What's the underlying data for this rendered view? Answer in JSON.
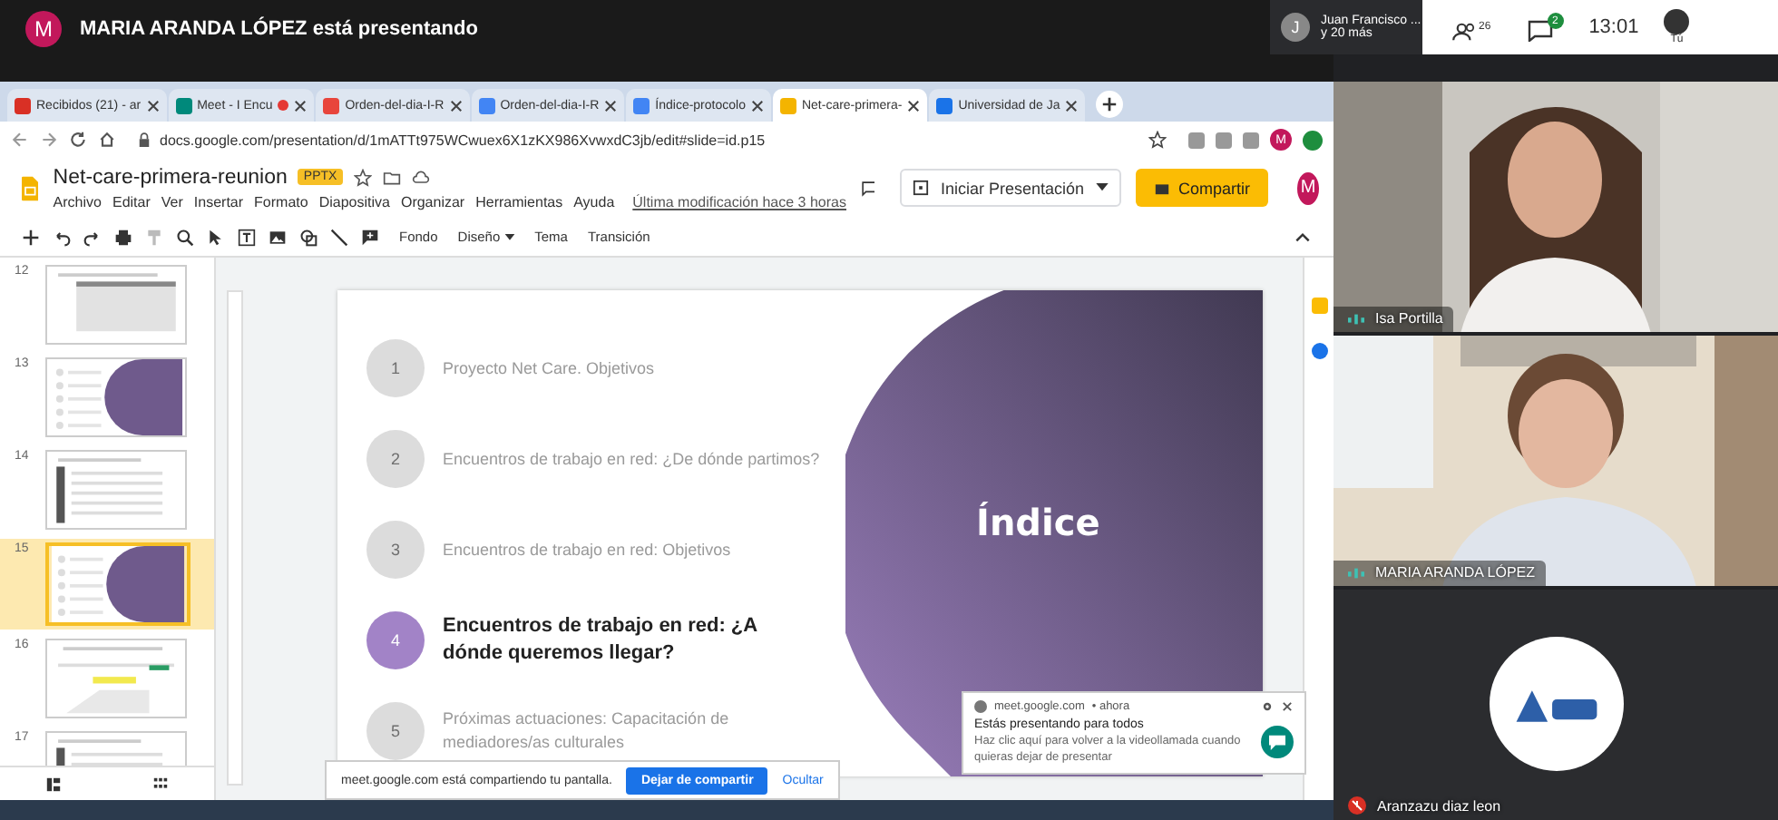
{
  "meet_bar": {
    "presenter_avatar": "M",
    "presenter_text": "MARIA ARANDA LÓPEZ está presentando",
    "others_avatar": "J",
    "others_name": "Juan Francisco ...",
    "others_more": "y 20 más",
    "people_count": "26",
    "chat_badge": "2",
    "time": "13:01",
    "self_label": "Tú"
  },
  "browser": {
    "tabs": [
      {
        "title": "Recibidos (21) - ar",
        "kind": "mail",
        "selected": false,
        "recording": false
      },
      {
        "title": "Meet - I Encu",
        "kind": "meet",
        "selected": false,
        "recording": true
      },
      {
        "title": "Orden-del-dia-I-R",
        "kind": "pdf",
        "selected": false,
        "recording": false
      },
      {
        "title": "Orden-del-dia-I-R",
        "kind": "doc",
        "selected": false,
        "recording": false
      },
      {
        "title": "Índice-protocolo",
        "kind": "doc",
        "selected": false,
        "recording": false
      },
      {
        "title": "Net-care-primera-",
        "kind": "slides",
        "selected": true,
        "recording": false
      },
      {
        "title": "Universidad de Ja",
        "kind": "calendar",
        "selected": false,
        "recording": false
      }
    ],
    "url": "docs.google.com/presentation/d/1mATTt975WCwuex6X1zKX986XvwxdC3jb/edit#slide=id.p15",
    "profile": "M"
  },
  "document": {
    "title": "Net-care-primera-reunion",
    "badge": "PPTX",
    "menus": [
      "Archivo",
      "Editar",
      "Ver",
      "Insertar",
      "Formato",
      "Diapositiva",
      "Organizar",
      "Herramientas",
      "Ayuda"
    ],
    "last_edit": "Última modificación hace 3 horas",
    "present_button": "Iniciar Presentación",
    "share_button": "Compartir",
    "avatar": "M",
    "toolbar": [
      "Fondo",
      "Diseño",
      "Tema",
      "Transición"
    ]
  },
  "slides": [
    {
      "number": "12",
      "kind": "table",
      "selected": false
    },
    {
      "number": "13",
      "kind": "index",
      "selected": false
    },
    {
      "number": "14",
      "kind": "text",
      "selected": false
    },
    {
      "number": "15",
      "kind": "index",
      "selected": true
    },
    {
      "number": "16",
      "kind": "form",
      "selected": false
    },
    {
      "number": "17",
      "kind": "text",
      "selected": false
    }
  ],
  "current_slide": {
    "title": "Índice",
    "items": [
      {
        "number": "1",
        "text": "Proyecto Net Care. Objetivos",
        "selected": false
      },
      {
        "number": "2",
        "text": "Encuentros de trabajo en red: ¿De dónde partimos?",
        "selected": false
      },
      {
        "number": "3",
        "text": "Encuentros de trabajo en red: Objetivos",
        "selected": false
      },
      {
        "number": "4",
        "text": "Encuentros de trabajo en red: ¿A dónde queremos llegar?",
        "selected": true
      },
      {
        "number": "5",
        "text": "Próximas actuaciones: Capacitación de mediadores/as culturales",
        "selected": false
      }
    ]
  },
  "share_bar": {
    "text": "meet.google.com está compartiendo tu pantalla.",
    "stop_button": "Dejar de compartir",
    "hide_link": "Ocultar"
  },
  "notification": {
    "source": "meet.google.com",
    "time": "• ahora",
    "title": "Estás presentando para todos",
    "body": "Haz clic aquí para volver a la videollamada cuando quieras dejar de presentar"
  },
  "participants": [
    {
      "name": "Isa Portilla",
      "kind": "video",
      "muted": false
    },
    {
      "name": "MARIA ARANDA LÓPEZ",
      "kind": "video",
      "muted": false
    },
    {
      "name": "Aranzazu diaz leon",
      "kind": "avatar",
      "muted": true
    }
  ]
}
